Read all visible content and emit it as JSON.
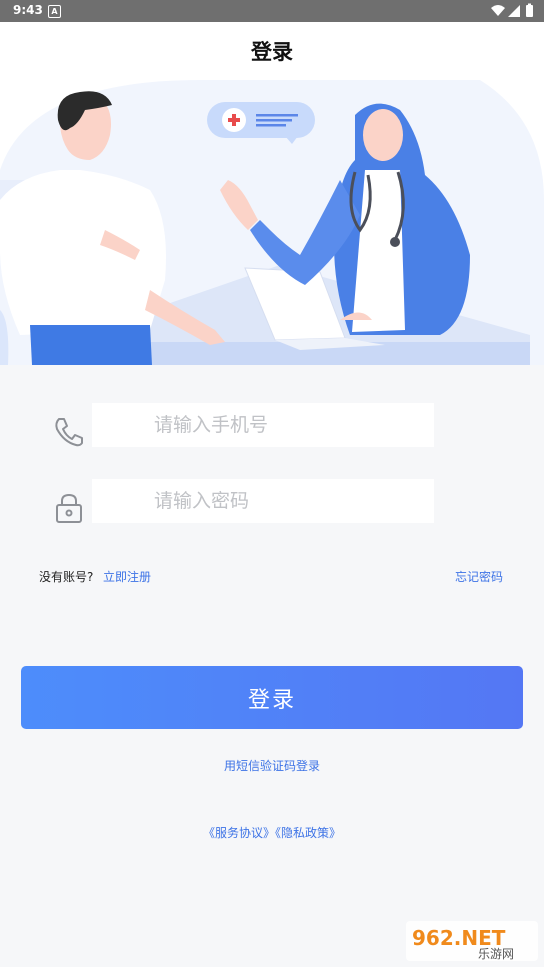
{
  "status_bar": {
    "time": "9:43",
    "notif_badge": "A",
    "icons": [
      "wifi-icon",
      "signal-icon",
      "battery-icon"
    ]
  },
  "header": {
    "title": "登录"
  },
  "hero": {
    "description_icons": [
      "medical-cross-icon",
      "chat-bubble-icon"
    ]
  },
  "form": {
    "phone_placeholder": "请输入手机号",
    "password_placeholder": "请输入密码",
    "no_account_text": "没有账号?",
    "register_link": "立即注册",
    "forgot_link": "忘记密码"
  },
  "actions": {
    "login_button": "登录",
    "sms_login_link": "用短信验证码登录",
    "service_agreement": "《服务协议》",
    "privacy_policy": "《隐私政策》"
  },
  "watermark": {
    "text": "962.NET",
    "subtext": "乐游网"
  },
  "colors": {
    "accent": "#3d73e6",
    "button_start": "#4d8dfb",
    "button_end": "#5477f4",
    "background": "#f6f7f9"
  }
}
